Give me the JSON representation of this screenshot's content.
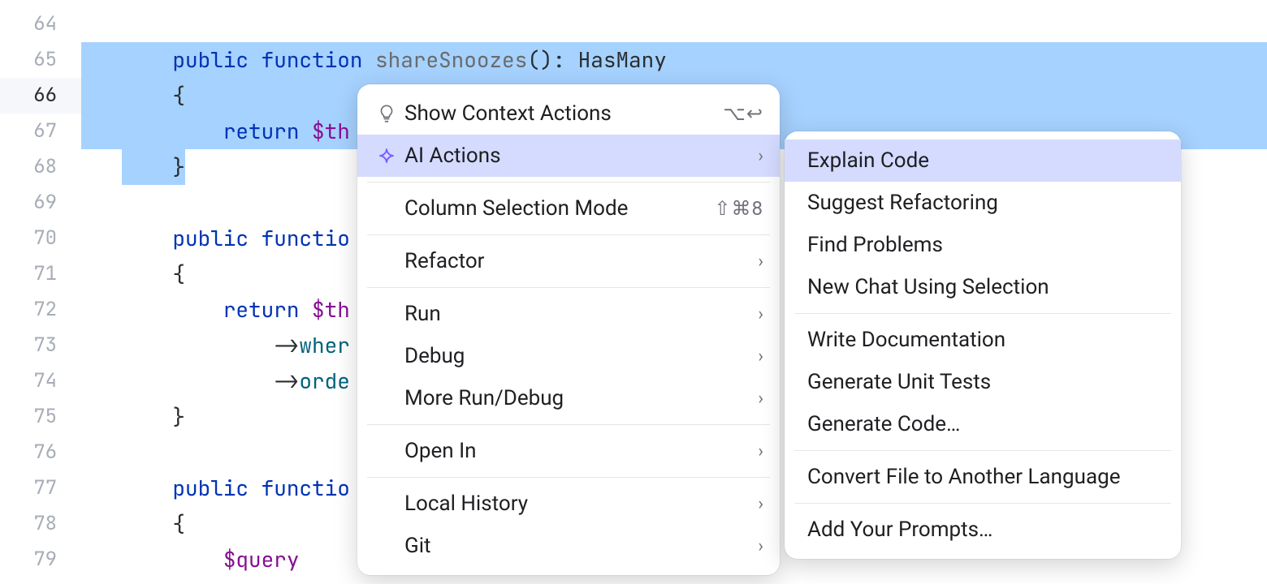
{
  "gutter": {
    "start": 64,
    "end": 79,
    "current": 66
  },
  "code": {
    "l64": "",
    "l65_kw1": "public",
    "l65_kw2": "function",
    "l65_fn": "shareSnoozes",
    "l65_paren": "()",
    "l65_colon": ": ",
    "l65_type": "HasMany",
    "l66": "{",
    "l67_kw": "return",
    "l67_var": "$th",
    "l68": "}",
    "l69": "",
    "l70_kw1": "public",
    "l70_kw2": "functio",
    "l71": "{",
    "l72_kw": "return",
    "l72_var": "$th",
    "l73_arrow": "->",
    "l73_m": "wher",
    "l74_arrow": "->",
    "l74_m": "orde",
    "l75": "}",
    "l76": "",
    "l77_kw1": "public",
    "l77_kw2": "functio",
    "l78": "{",
    "l79_var": "$query"
  },
  "mainMenu": {
    "items": [
      {
        "label": "Show Context Actions",
        "icon": "bulb",
        "shortcut": "⌥↩",
        "submenu": false,
        "highlight": false
      },
      {
        "label": "AI Actions",
        "icon": "ai",
        "shortcut": "",
        "submenu": true,
        "highlight": true
      },
      {
        "sep": true
      },
      {
        "label": "Column Selection Mode",
        "icon": "",
        "shortcut": "⇧⌘8",
        "submenu": false,
        "highlight": false
      },
      {
        "sep": true
      },
      {
        "label": "Refactor",
        "icon": "",
        "shortcut": "",
        "submenu": true,
        "highlight": false
      },
      {
        "sep": true
      },
      {
        "label": "Run",
        "icon": "",
        "shortcut": "",
        "submenu": true,
        "highlight": false
      },
      {
        "label": "Debug",
        "icon": "",
        "shortcut": "",
        "submenu": true,
        "highlight": false
      },
      {
        "label": "More Run/Debug",
        "icon": "",
        "shortcut": "",
        "submenu": true,
        "highlight": false
      },
      {
        "sep": true
      },
      {
        "label": "Open In",
        "icon": "",
        "shortcut": "",
        "submenu": true,
        "highlight": false
      },
      {
        "sep": true
      },
      {
        "label": "Local History",
        "icon": "",
        "shortcut": "",
        "submenu": true,
        "highlight": false
      },
      {
        "label": "Git",
        "icon": "",
        "shortcut": "",
        "submenu": true,
        "highlight": false
      }
    ]
  },
  "subMenu": {
    "items": [
      {
        "label": "Explain Code",
        "highlight": true
      },
      {
        "label": "Suggest Refactoring",
        "highlight": false
      },
      {
        "label": "Find Problems",
        "highlight": false
      },
      {
        "label": "New Chat Using Selection",
        "highlight": false
      },
      {
        "sep": true
      },
      {
        "label": "Write Documentation",
        "highlight": false
      },
      {
        "label": "Generate Unit Tests",
        "highlight": false
      },
      {
        "label": "Generate Code…",
        "highlight": false
      },
      {
        "sep": true
      },
      {
        "label": "Convert File to Another Language",
        "highlight": false
      },
      {
        "sep": true
      },
      {
        "label": "Add Your Prompts…",
        "highlight": false
      }
    ]
  }
}
